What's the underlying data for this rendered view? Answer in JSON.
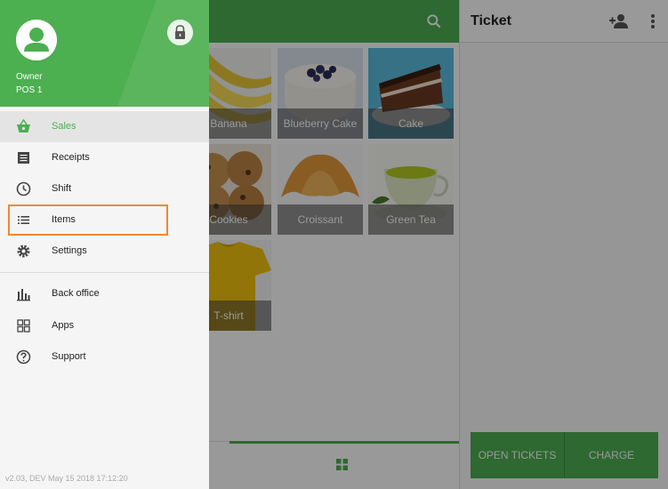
{
  "drawer": {
    "user_name": "Owner",
    "pos_name": "POS 1",
    "version": "v2.03, DEV May 15 2018 17:12:20",
    "menu": [
      {
        "label": "Sales",
        "icon": "basket-icon",
        "active": true
      },
      {
        "label": "Receipts",
        "icon": "receipt-icon"
      },
      {
        "label": "Shift",
        "icon": "clock-icon"
      },
      {
        "label": "Items",
        "icon": "list-icon"
      },
      {
        "label": "Settings",
        "icon": "gear-icon"
      },
      {
        "label": "Back office",
        "icon": "bar-chart-icon"
      },
      {
        "label": "Apps",
        "icon": "apps-icon"
      },
      {
        "label": "Support",
        "icon": "help-icon"
      }
    ]
  },
  "items": [
    {
      "label": "Banana"
    },
    {
      "label": "Blueberry Cake"
    },
    {
      "label": "Cake"
    },
    {
      "label": "Cookies"
    },
    {
      "label": "Croissant"
    },
    {
      "label": "Green Tea"
    },
    {
      "label": "T-shirt"
    }
  ],
  "ticket": {
    "title": "Ticket",
    "open_tickets_label": "OPEN TICKETS",
    "charge_label": "CHARGE"
  },
  "colors": {
    "accent": "#4caf50",
    "highlight": "#ef8733"
  }
}
